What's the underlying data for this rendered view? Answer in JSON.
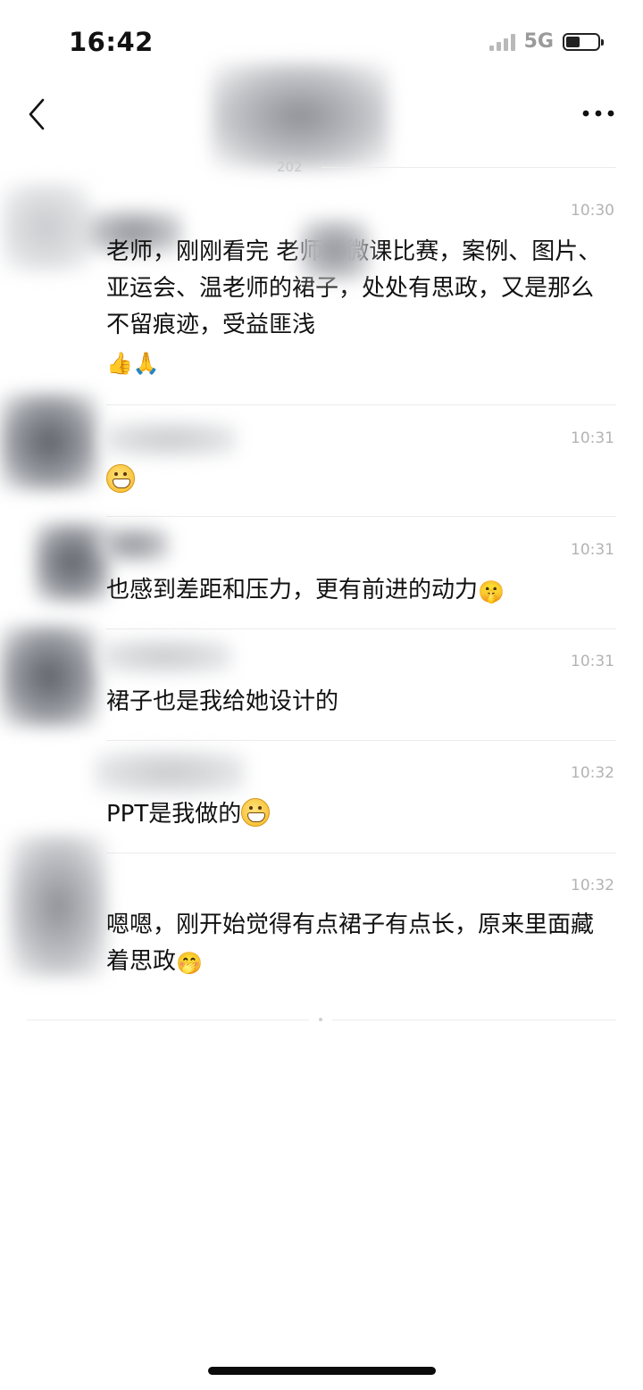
{
  "status_bar": {
    "time": "16:42",
    "network": "5G",
    "battery_level": 0.45
  },
  "header": {
    "title_fragment": "202",
    "back_icon": "chevron-left-icon",
    "more_icon": "ellipsis-icon"
  },
  "messages": [
    {
      "time": "10:30",
      "text": "老师，刚刚看完 老师的微课比赛，案例、图片、亚运会、温老师的裙子，处处有思政，又是那么不留痕迹，受益匪浅",
      "emoji": "👍🙏"
    },
    {
      "time": "10:31",
      "text": "",
      "emoji": "😁"
    },
    {
      "time": "10:31",
      "text": "也感到差距和压力，更有前进的动力",
      "emoji": "🤫"
    },
    {
      "time": "10:31",
      "text": "裙子也是我给她设计的",
      "emoji": ""
    },
    {
      "time": "10:32",
      "text": "PPT是我做的",
      "emoji": "😁"
    },
    {
      "time": "10:32",
      "text": "嗯嗯，刚开始觉得有点裙子有点长，原来里面藏着思政",
      "emoji": "🤭"
    }
  ]
}
